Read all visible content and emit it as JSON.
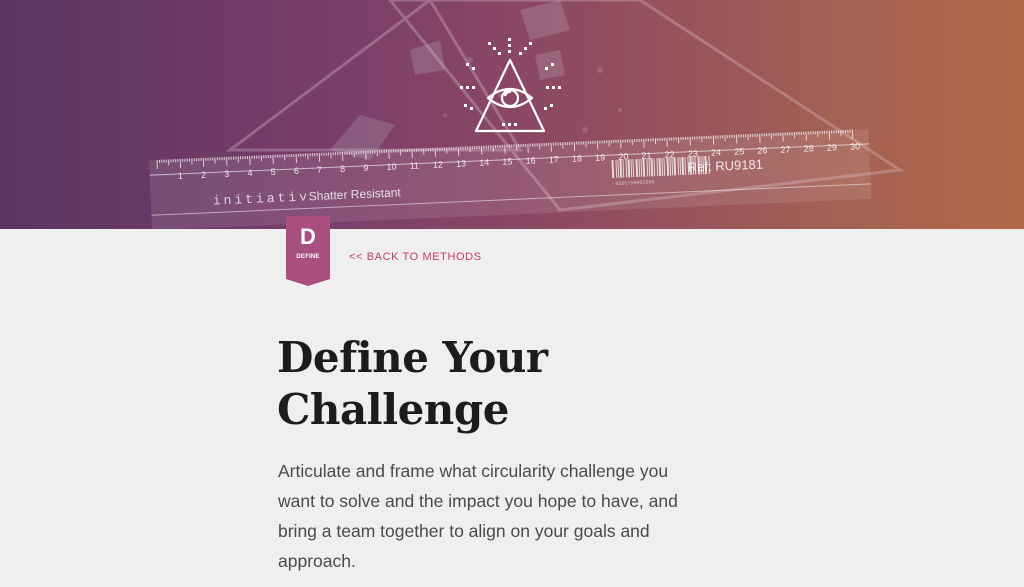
{
  "hero": {
    "icon": "eye-in-triangle-icon",
    "ruler_text": {
      "brand": "initiativ",
      "resistance": "Shatter Resistant",
      "ref": "Ref: RU9181",
      "barcode_number": "0265750002806",
      "numbers": [
        "1",
        "2",
        "3",
        "4",
        "5",
        "6",
        "7",
        "8",
        "9",
        "10",
        "11",
        "12",
        "13",
        "14",
        "15",
        "16",
        "17",
        "18",
        "19",
        "20",
        "21",
        "22",
        "23",
        "24",
        "25",
        "26",
        "27",
        "28",
        "29",
        "30"
      ]
    }
  },
  "badge": {
    "letter": "D",
    "label": "DEFINE",
    "color": "#a84f7f"
  },
  "nav": {
    "back_label": "<< BACK TO METHODS",
    "accent_color": "#c23a6d"
  },
  "content": {
    "title": "Define Your Challenge",
    "description": "Articulate and frame what circularity challenge you want to solve and the impact you hope to have, and bring a team together to align on your goals and approach."
  }
}
